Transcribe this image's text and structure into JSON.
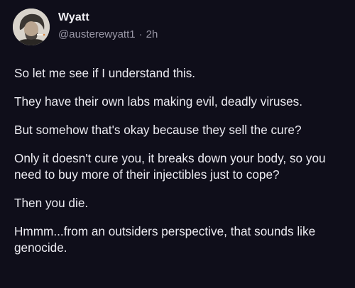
{
  "post": {
    "author_name": "Wyatt",
    "handle": "@austerewyatt1",
    "separator": "·",
    "time": "2h",
    "paragraphs": [
      "So let me see if I understand this.",
      "They have their own labs making evil, deadly viruses.",
      "But somehow that's okay because they sell the cure?",
      "Only it doesn't cure you, it breaks down your body, so you need to buy more of their injectibles just to cope?",
      "Then you die.",
      "Hmmm...from an outsiders perspective, that sounds like genocide."
    ]
  },
  "colors": {
    "background": "#0f0e1a",
    "text": "#ecebf1",
    "muted": "#9b99a8"
  },
  "icons": {
    "avatar": "profile-photo"
  }
}
